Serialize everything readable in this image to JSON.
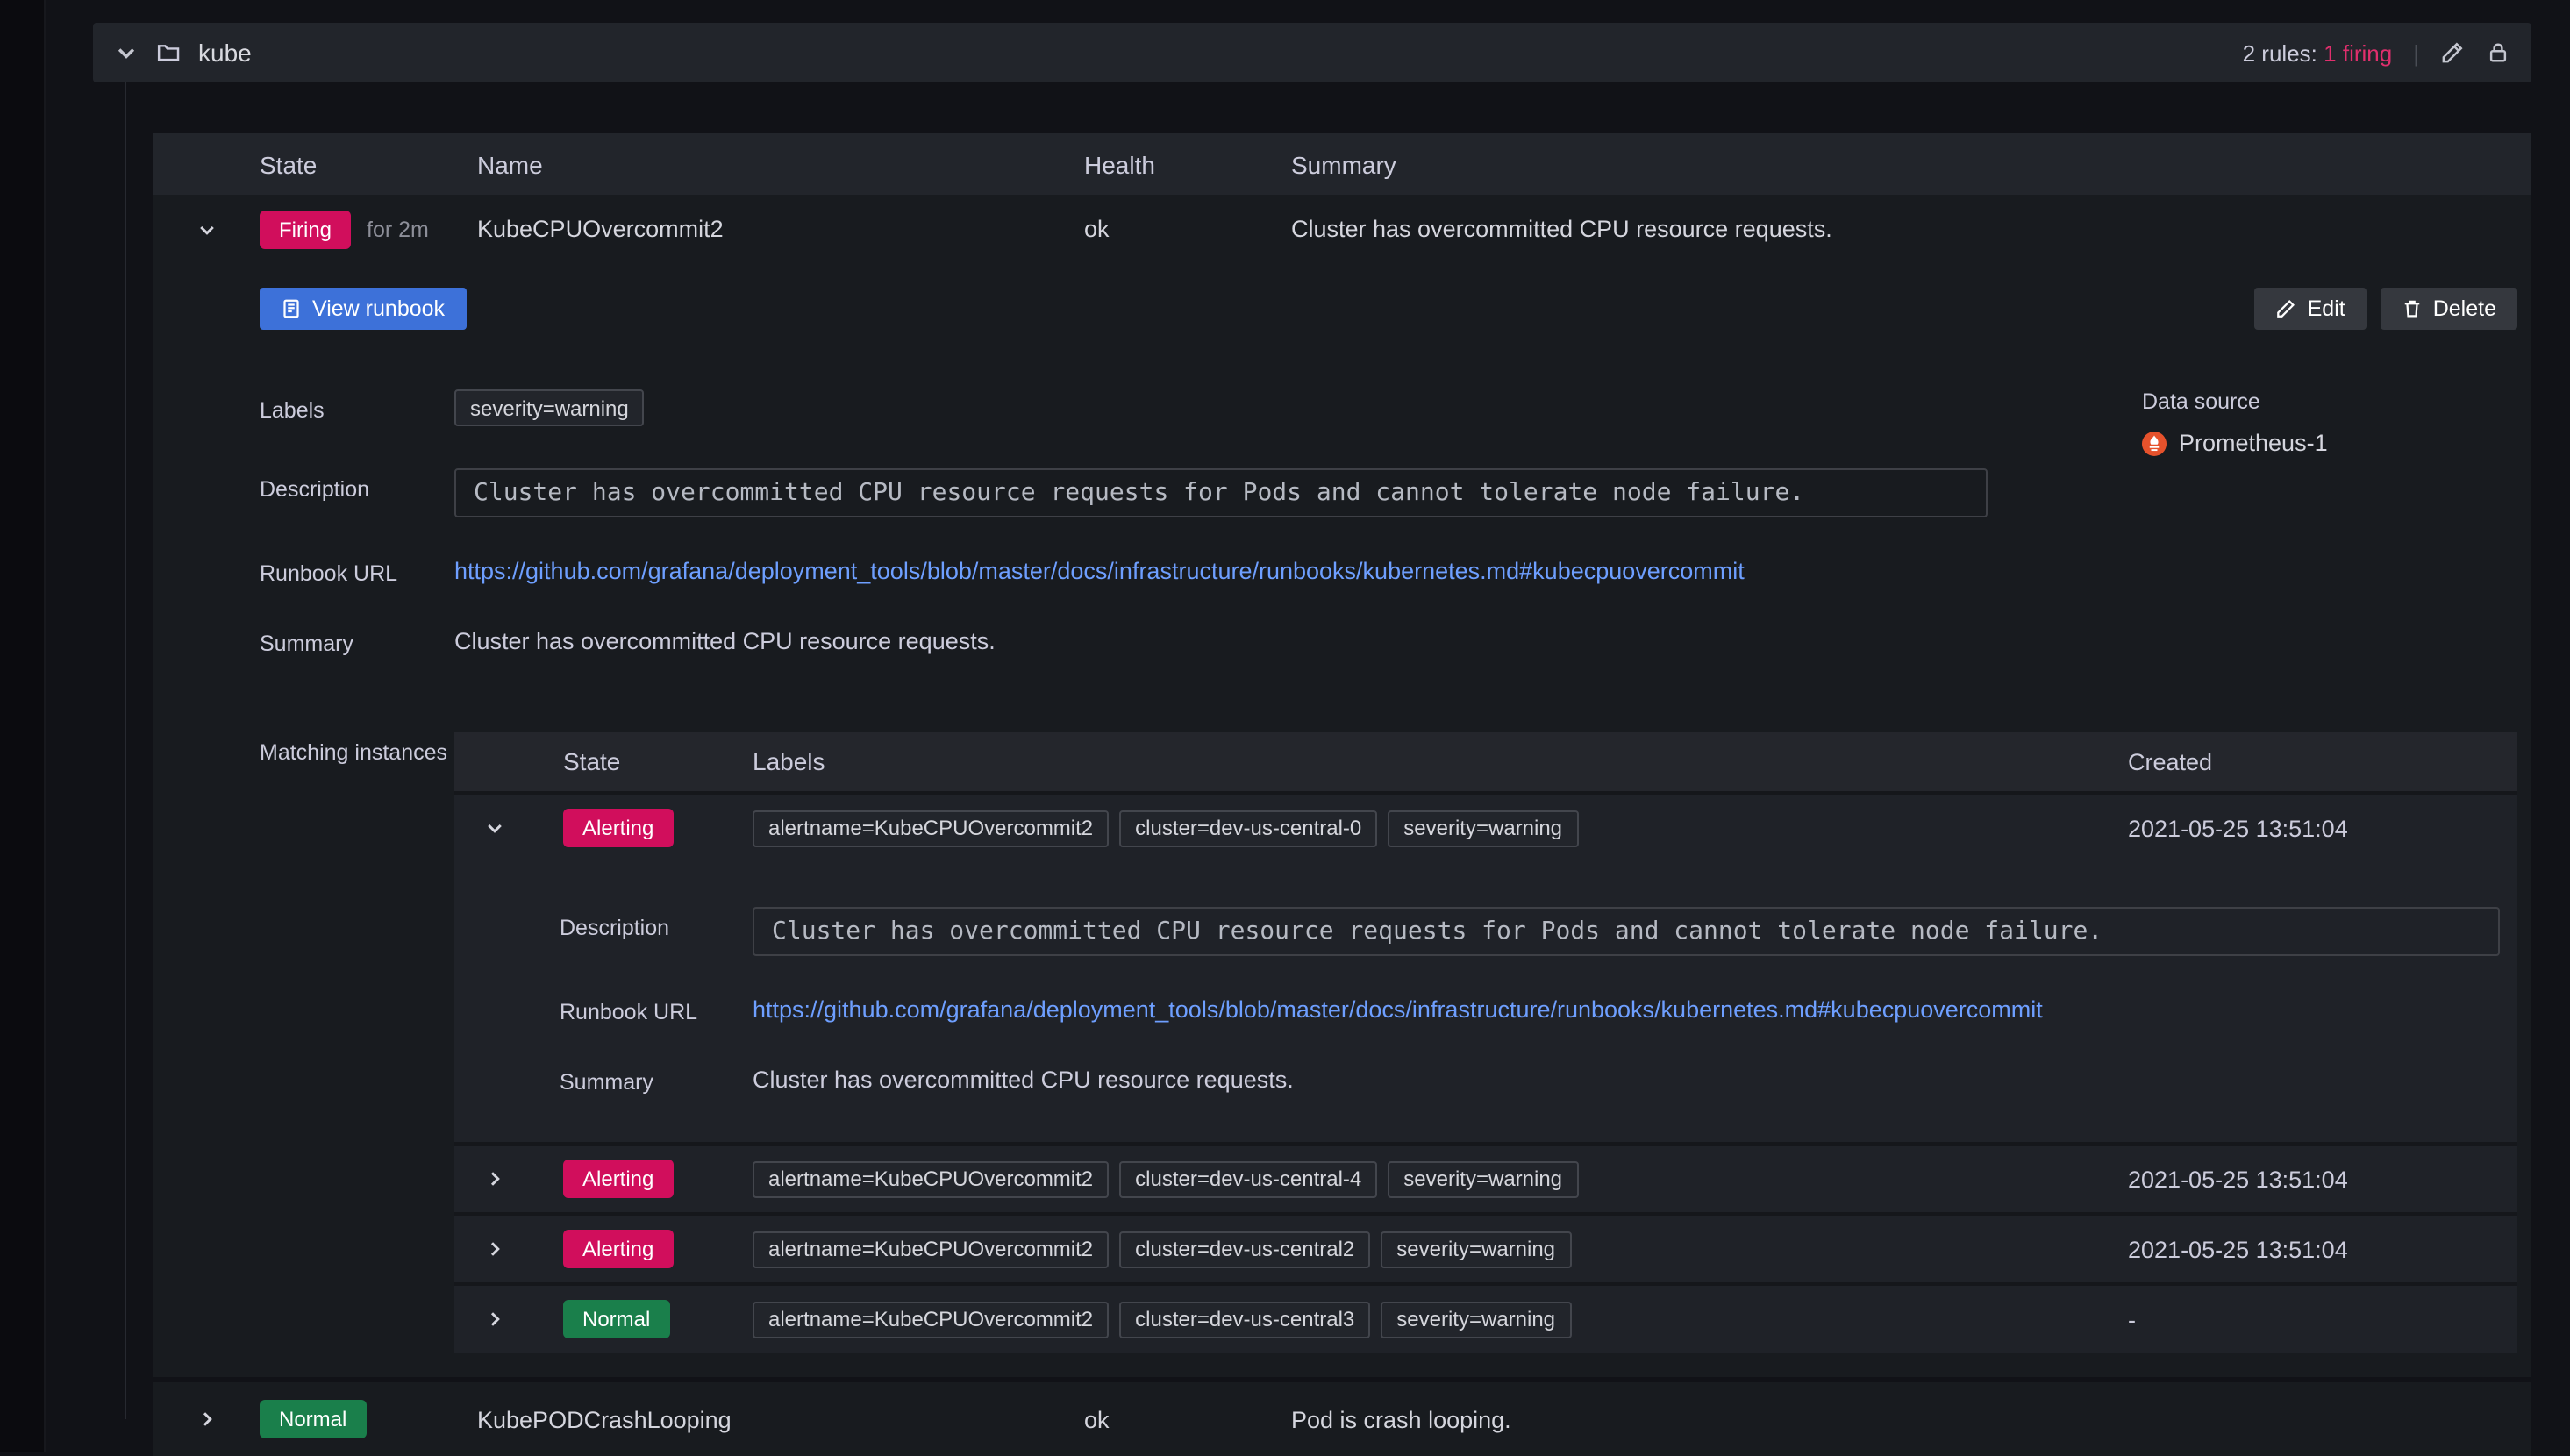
{
  "colors": {
    "firing": "#d10e5c",
    "firing_text": "#e02f6d",
    "normal": "#1a7f4b",
    "link": "#6e9fff",
    "primary_button": "#3d71d9",
    "prometheus": "#e6522c"
  },
  "group": {
    "name": "kube",
    "rules_summary": "2 rules:",
    "firing_count": "1 firing",
    "divider": "|"
  },
  "rules_table": {
    "headers": {
      "state": "State",
      "name": "Name",
      "health": "Health",
      "summary": "Summary"
    }
  },
  "rule_firing": {
    "state": "Firing",
    "for_duration": "for 2m",
    "name": "KubeCPUOvercommit2",
    "health": "ok",
    "summary": "Cluster has overcommitted CPU resource requests.",
    "actions": {
      "view_runbook": "View runbook",
      "edit": "Edit",
      "delete": "Delete"
    },
    "details": {
      "labels_label": "Labels",
      "labels": [
        "severity=warning"
      ],
      "description_label": "Description",
      "description": "Cluster has overcommitted CPU resource requests for Pods and cannot tolerate node failure.",
      "runbook_label": "Runbook URL",
      "runbook_url": "https://github.com/grafana/deployment_tools/blob/master/docs/infrastructure/runbooks/kubernetes.md#kubecpuovercommit",
      "summary_label": "Summary",
      "summary": "Cluster has overcommitted CPU resource requests.",
      "matching_instances_label": "Matching instances",
      "data_source_label": "Data source",
      "data_source_name": "Prometheus-1"
    },
    "instances": {
      "headers": {
        "state": "State",
        "labels": "Labels",
        "created": "Created"
      },
      "rows": [
        {
          "state": "Alerting",
          "labels": [
            "alertname=KubeCPUOvercommit2",
            "cluster=dev-us-central-0",
            "severity=warning"
          ],
          "created": "2021-05-25 13:51:04"
        },
        {
          "state": "Alerting",
          "labels": [
            "alertname=KubeCPUOvercommit2",
            "cluster=dev-us-central-4",
            "severity=warning"
          ],
          "created": "2021-05-25 13:51:04"
        },
        {
          "state": "Alerting",
          "labels": [
            "alertname=KubeCPUOvercommit2",
            "cluster=dev-us-central2",
            "severity=warning"
          ],
          "created": "2021-05-25 13:51:04"
        },
        {
          "state": "Normal",
          "labels": [
            "alertname=KubeCPUOvercommit2",
            "cluster=dev-us-central3",
            "severity=warning"
          ],
          "created": "-"
        }
      ],
      "expanded_detail": {
        "description_label": "Description",
        "description": "Cluster has overcommitted CPU resource requests for Pods and cannot tolerate node failure.",
        "runbook_label": "Runbook URL",
        "runbook_url": "https://github.com/grafana/deployment_tools/blob/master/docs/infrastructure/runbooks/kubernetes.md#kubecpuovercommit",
        "summary_label": "Summary",
        "summary": "Cluster has overcommitted CPU resource requests."
      }
    }
  },
  "rule_normal": {
    "state": "Normal",
    "name": "KubePODCrashLooping",
    "health": "ok",
    "summary": "Pod is crash looping."
  }
}
